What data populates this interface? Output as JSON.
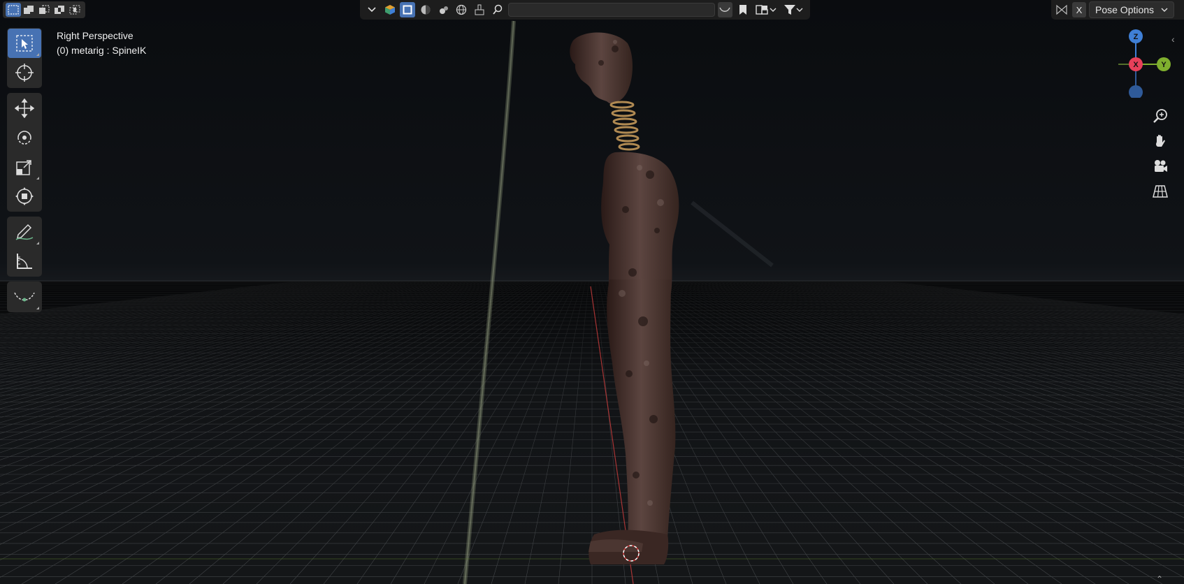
{
  "viewport": {
    "view_name": "Right Perspective",
    "active_object": "(0) metarig : SpineIK"
  },
  "header": {
    "select_modes": [
      {
        "name": "select-box-mode",
        "active": true
      },
      {
        "name": "extend-mode",
        "active": false
      },
      {
        "name": "subtract-mode",
        "active": false
      },
      {
        "name": "difference-mode",
        "active": false
      },
      {
        "name": "intersect-mode",
        "active": false
      }
    ],
    "search": {
      "placeholder": ""
    },
    "close_label": "X",
    "pose_options_label": "Pose Options"
  },
  "toolbar": {
    "tools": [
      {
        "name": "select-box-tool",
        "icon": "cursor-select-icon",
        "active": true
      },
      {
        "name": "cursor-tool",
        "icon": "3d-cursor-icon",
        "active": false
      },
      {
        "name": "move-tool",
        "icon": "move-arrows-icon",
        "active": false
      },
      {
        "name": "rotate-tool",
        "icon": "rotate-icon",
        "active": false
      },
      {
        "name": "scale-tool",
        "icon": "scale-icon",
        "active": false
      },
      {
        "name": "transform-tool",
        "icon": "transform-icon",
        "active": false
      },
      {
        "name": "annotate-tool",
        "icon": "pencil-icon",
        "active": false
      },
      {
        "name": "measure-tool",
        "icon": "ruler-icon",
        "active": false
      },
      {
        "name": "relax-pose-tool",
        "icon": "curve-icon",
        "active": false
      }
    ]
  },
  "gizmo": {
    "z_label": "Z",
    "x_label": "X",
    "y_label": "Y",
    "colors": {
      "x": "#e8405a",
      "y": "#7faf2e",
      "z": "#3f7fd6"
    }
  },
  "nav_buttons": [
    "zoom-icon",
    "pan-hand-icon",
    "camera-icon",
    "grid-perspective-icon"
  ],
  "colors": {
    "accent": "#4772b3",
    "header_bg": "#1d1d1d",
    "panel_bg": "#2a2a2a"
  }
}
